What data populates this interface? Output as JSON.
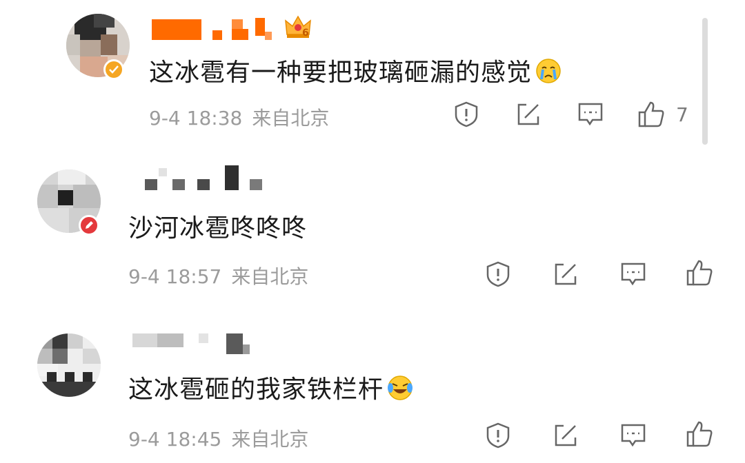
{
  "comments": [
    {
      "text": "这冰雹有一种要把玻璃砸漏的感觉",
      "emoji": "crying-face",
      "time": "9-4 18:38",
      "location": "来自北京",
      "likes": "7",
      "badge": "verified",
      "crown_level": "6"
    },
    {
      "text": "沙河冰雹咚咚咚",
      "time": "9-4 18:57",
      "location": "来自北京",
      "likes": "",
      "badge": "pencil"
    },
    {
      "text": "这冰雹砸的我家铁栏杆",
      "emoji": "laugh-cry-face",
      "time": "9-4 18:45",
      "location": "来自北京",
      "likes": ""
    }
  ],
  "icons": {
    "report": "shield-alert-icon",
    "share": "share-icon",
    "reply": "comment-icon",
    "like": "thumbs-up-icon"
  },
  "colors": {
    "name_orange": "#ff6a00",
    "verified_gold": "#f5a623",
    "pencil_red": "#e4393c",
    "meta_gray": "#9b9b9b"
  }
}
